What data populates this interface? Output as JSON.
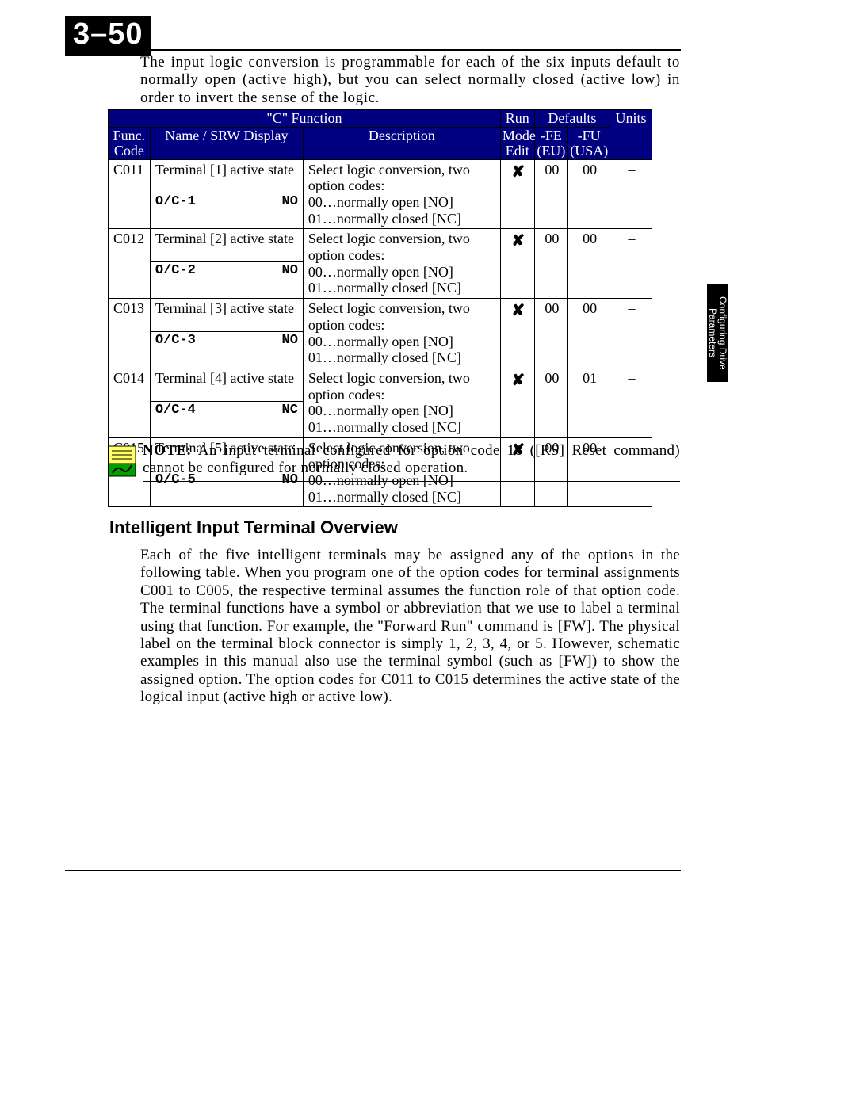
{
  "page_number": "3–50",
  "intro": "The input logic conversion is programmable for each of the six inputs default to normally open (active high), but you can select normally closed (active low) in order to invert the sense of the logic.",
  "table": {
    "header_c_function": "\"C\" Function",
    "header_run": "Run",
    "header_defaults": "Defaults",
    "header_func_code": "Func. Code",
    "header_name_srw": "Name / SRW Display",
    "header_description": "Description",
    "header_mode_edit": "Mode Edit",
    "header_fe": "-FE (EU)",
    "header_fu": "-FU (USA)",
    "header_units": "Units",
    "desc_lines": [
      "Select logic conversion, two option codes:",
      "00…normally open [NO]",
      "01…normally closed [NC]"
    ],
    "run_mark": "✘",
    "rows": [
      {
        "code": "C011",
        "name": "Terminal [1] active state",
        "srw_code": "O/C-1",
        "srw_val": "NO",
        "fe": "00",
        "fu": "00",
        "units": "–"
      },
      {
        "code": "C012",
        "name": "Terminal [2] active state",
        "srw_code": "O/C-2",
        "srw_val": "NO",
        "fe": "00",
        "fu": "00",
        "units": "–"
      },
      {
        "code": "C013",
        "name": "Terminal [3] active state",
        "srw_code": "O/C-3",
        "srw_val": "NO",
        "fe": "00",
        "fu": "00",
        "units": "–"
      },
      {
        "code": "C014",
        "name": "Terminal [4] active state",
        "srw_code": "O/C-4",
        "srw_val": "NC",
        "fe": "00",
        "fu": "01",
        "units": "–"
      },
      {
        "code": "C015",
        "name": "Terminal [5] active state",
        "srw_code": "O/C-5",
        "srw_val": "NO",
        "fe": "00",
        "fu": "00",
        "units": "–"
      }
    ]
  },
  "note": {
    "label": "NOTE:",
    "text": " An input terminal configured for option code 18 ([RS] Reset command) cannot be configured for normally closed operation."
  },
  "section_heading": "Intelligent Input Terminal Overview",
  "overview": "Each of the five intelligent terminals may be assigned any of the options in the following table. When you program one of the option codes for terminal assignments C001 to C005, the respective terminal assumes the function role of that option code. The terminal functions have a symbol or abbreviation that we use to label a terminal using that function. For example, the \"Forward Run\" command is [FW]. The physical label on the terminal block connector is simply 1, 2, 3, 4, or 5. However, schematic examples in this manual also use the terminal symbol (such as [FW]) to show the assigned option. The option codes for C011 to C015 determines the active state of the logical input (active high or active low).",
  "side_tab": "Configuring Drive Parameters"
}
